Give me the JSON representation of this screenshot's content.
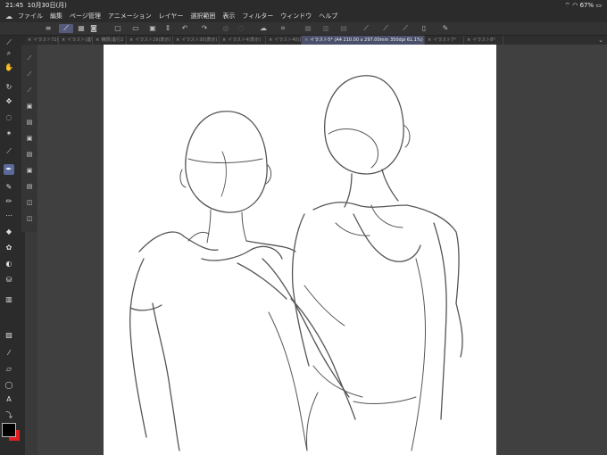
{
  "status": {
    "time": "21:45",
    "date": "10月30日(月)",
    "battery": "67%"
  },
  "menu": [
    "ファイル",
    "編集",
    "ページ管理",
    "アニメーション",
    "レイヤー",
    "選択範囲",
    "表示",
    "フィルター",
    "ウィンドウ",
    "ヘルプ"
  ],
  "tabs": [
    {
      "label": "イラスト72(表",
      "active": false
    },
    {
      "label": "イラスト(進行2",
      "active": false
    },
    {
      "label": "横顔(進行2",
      "active": false
    },
    {
      "label": "イラスト29(表示)",
      "active": false
    },
    {
      "label": "イラスト30(表示)",
      "active": false
    },
    {
      "label": "イラスト4(表示)",
      "active": false
    },
    {
      "label": "イラスト40(表",
      "active": false
    },
    {
      "label": "イラスト5* (A4 210.00 x 297.00mm 350dpi 61.1%)",
      "active": true
    },
    {
      "label": "イラスト7*",
      "active": false
    },
    {
      "label": "イラスト8*",
      "active": false
    }
  ],
  "tools": {
    "main": [
      "eyedropper-icon",
      "zoom-icon",
      "hand-icon",
      "rotate-icon",
      "move-icon",
      "lasso-icon",
      "magic-wand-icon",
      "eyedropper2-icon",
      "pen-icon",
      "pencil-icon",
      "brush-icon",
      "airbrush-icon",
      "eraser-icon",
      "decoration-icon",
      "blend-icon",
      "fill-icon",
      "gradient-icon",
      "figure-icon",
      "ruler-icon",
      "line-icon",
      "balloon-icon",
      "text-icon",
      "correct-line-icon"
    ],
    "sub": [
      "sub-a-icon",
      "sub-b-icon",
      "sub-c-icon",
      "sub-d-icon",
      "sub-e-icon",
      "sub-f-icon",
      "sub-g-icon",
      "sub-h-icon",
      "sub-i-icon",
      "sub-j-icon",
      "sub-k-icon"
    ],
    "text_tool": "A"
  },
  "colors": {
    "foreground": "#000000",
    "background": "#e02020"
  }
}
